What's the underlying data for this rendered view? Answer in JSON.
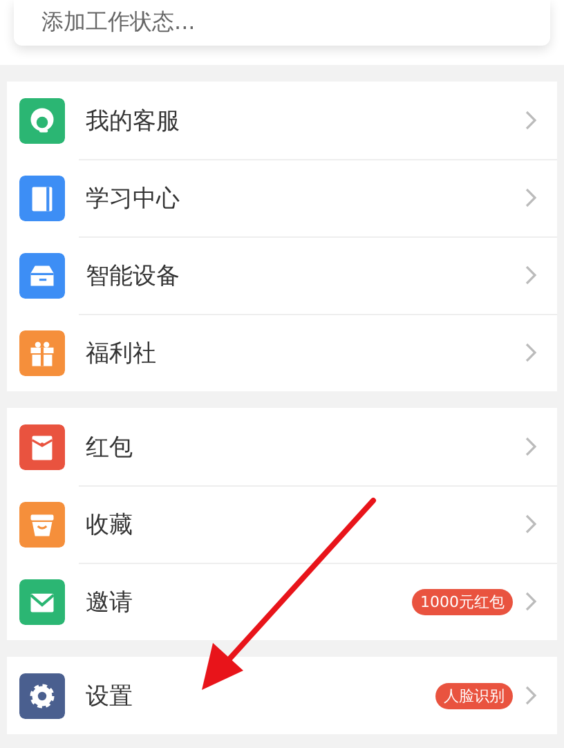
{
  "status_card": {
    "text": "添加工作状态..."
  },
  "groups": [
    {
      "items": [
        {
          "kind": "service",
          "label": "我的客服"
        },
        {
          "kind": "book",
          "label": "学习中心"
        },
        {
          "kind": "device",
          "label": "智能设备"
        },
        {
          "kind": "gift",
          "label": "福利社"
        }
      ]
    },
    {
      "items": [
        {
          "kind": "envelope",
          "label": "红包"
        },
        {
          "kind": "basket",
          "label": "收藏"
        },
        {
          "kind": "mail",
          "label": "邀请",
          "badge": "1000元红包"
        }
      ]
    },
    {
      "items": [
        {
          "kind": "gear",
          "label": "设置",
          "badge": "人脸识别"
        }
      ]
    }
  ],
  "annotation": {
    "kind": "arrow"
  }
}
